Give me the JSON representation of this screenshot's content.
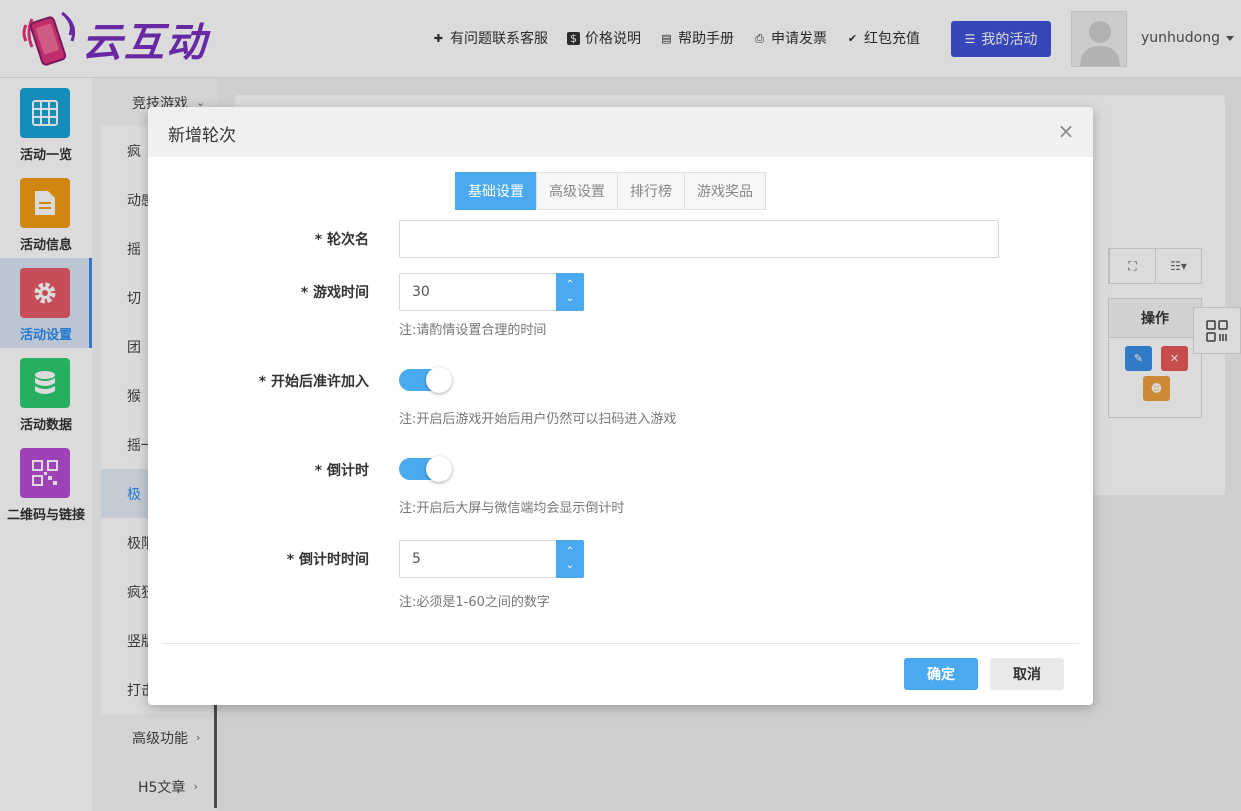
{
  "header": {
    "logo_text": "云互动",
    "links": [
      {
        "label": "有问题联系客服",
        "icon": "user-plus-icon"
      },
      {
        "label": "价格说明",
        "icon": "dollar-icon"
      },
      {
        "label": "帮助手册",
        "icon": "book-icon"
      },
      {
        "label": "申请发票",
        "icon": "printer-icon"
      },
      {
        "label": "红包充值",
        "icon": "shield-check-icon"
      }
    ],
    "my_activity": "我的活动",
    "username": "yunhudong",
    "brand_color": "#3f53d9"
  },
  "rail": {
    "items": [
      {
        "label": "活动一览",
        "icon": "grid-icon",
        "color": "#1aa3d9"
      },
      {
        "label": "活动信息",
        "icon": "document-icon",
        "color": "#f39c12"
      },
      {
        "label": "活动设置",
        "icon": "gear-icon",
        "color": "#e85a6a"
      },
      {
        "label": "活动数据",
        "icon": "database-icon",
        "color": "#2ecc71"
      },
      {
        "label": "二维码与链接",
        "icon": "qrcode-icon",
        "color": "#b84fd6"
      }
    ]
  },
  "subnav": {
    "group_top": "竞技游戏",
    "items": [
      "疯",
      "动感",
      "摇",
      "切",
      "团",
      "猴",
      "摇一",
      "极",
      "极限",
      "疯狂",
      "竖版",
      "打击"
    ],
    "group_advanced": "高级功能",
    "group_h5": "H5文章"
  },
  "card": {
    "th_ops": "操作"
  },
  "modal": {
    "title": "新增轮次",
    "tabs": [
      "基础设置",
      "高级设置",
      "排行榜",
      "游戏奖品"
    ],
    "fields": {
      "round_name_label": "* 轮次名",
      "round_name_value": "",
      "game_time_label": "* 游戏时间",
      "game_time_value": "30",
      "game_time_hint": "注:请酌情设置合理的时间",
      "allow_join_label": "* 开始后准许加入",
      "allow_join_hint": "注:开启后游戏开始后用户仍然可以扫码进入游戏",
      "allow_join_on": true,
      "countdown_label": "* 倒计时",
      "countdown_hint": "注:开启后大屏与微信端均会显示倒计时",
      "countdown_on": true,
      "countdown_time_label": "* 倒计时时间",
      "countdown_time_value": "5",
      "countdown_time_hint": "注:必须是1-60之间的数字"
    },
    "ok": "确定",
    "cancel": "取消",
    "accent": "#4aa9f0"
  }
}
